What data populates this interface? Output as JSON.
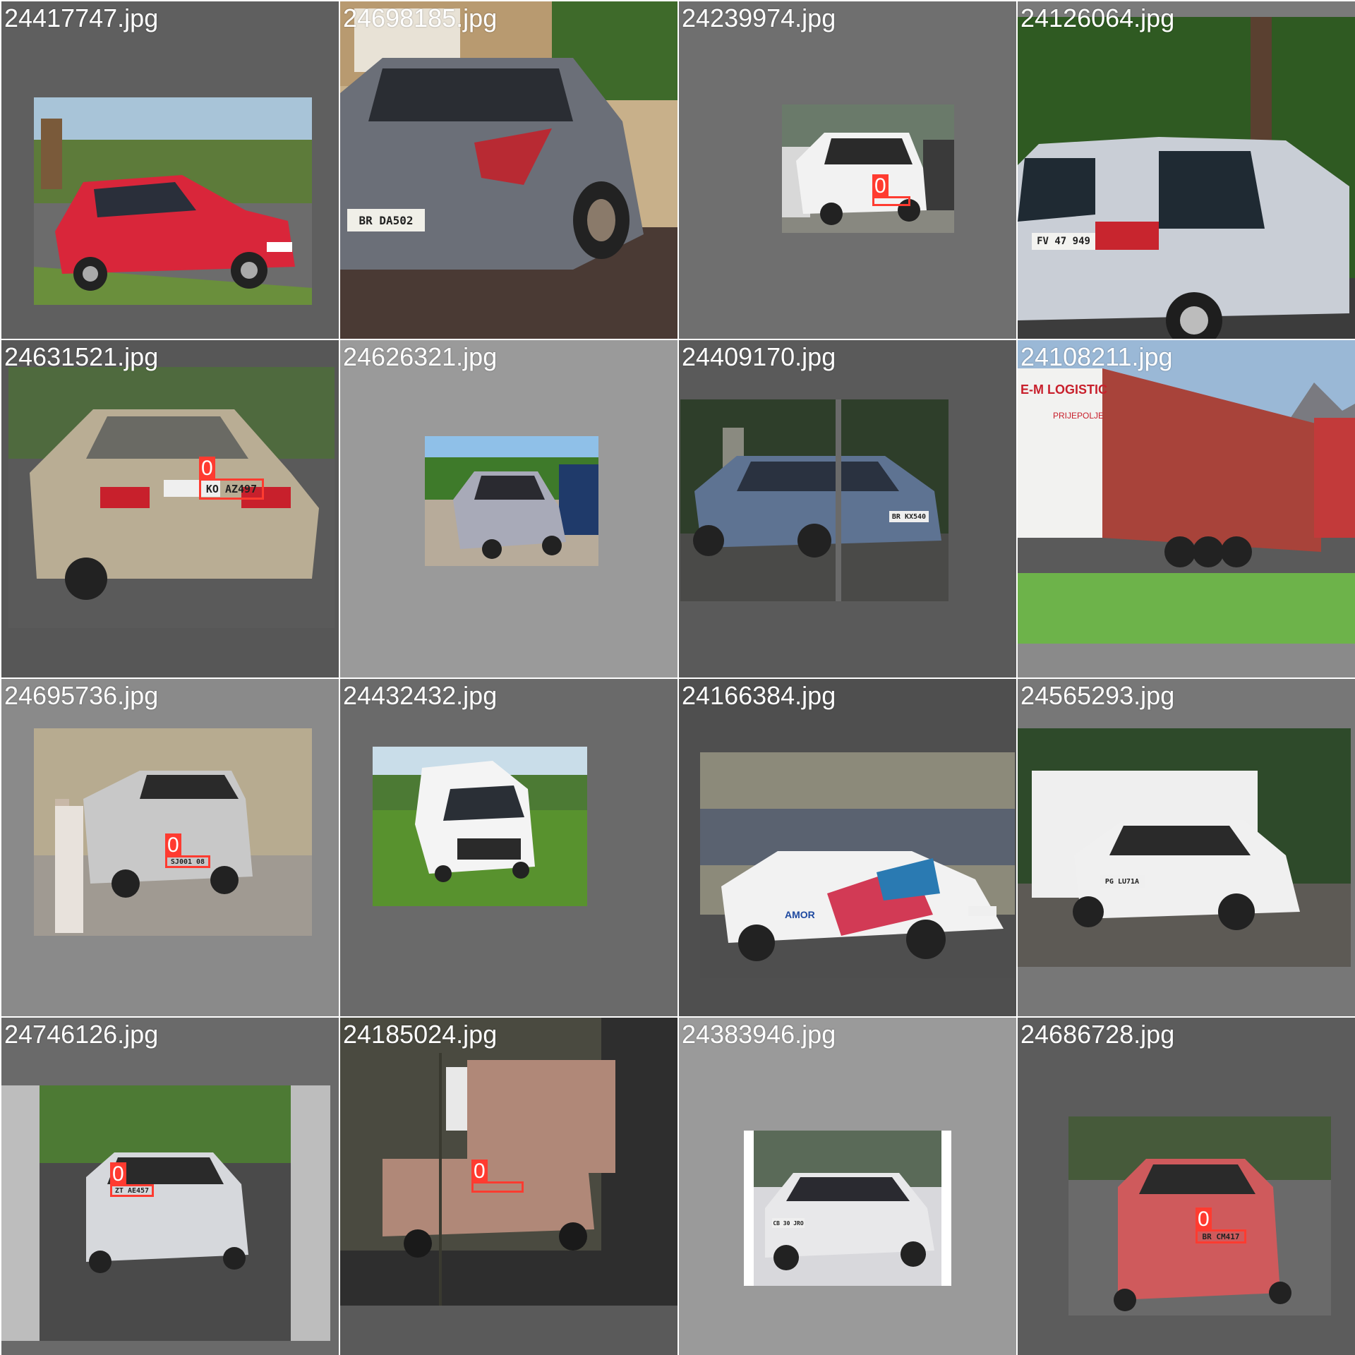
{
  "detection_class_label": "0",
  "box_color": "#ff3b30",
  "tiles": [
    {
      "filename": "24417747.jpg",
      "bg": "#5f5f5f",
      "car_color": "#d9263a",
      "sky": "#a8c4d8",
      "ground": "#6a8f3c"
    },
    {
      "filename": "24698185.jpg",
      "bg": "#8c8c8c",
      "car_color": "#6b6f78",
      "sky": "#c8b08a",
      "ground": "#4a3a34",
      "plate_text": "BR DA502"
    },
    {
      "filename": "24239974.jpg",
      "bg": "#6f6f6f",
      "car_color": "#f2f2f2",
      "sky": "#6a7a6a",
      "ground": "#888880"
    },
    {
      "filename": "24126064.jpg",
      "bg": "#7a7a7a",
      "car_color": "#c9ced6",
      "sky": "#2f5a22",
      "ground": "#3c3c3c",
      "plate_text": "FV 47 949"
    },
    {
      "filename": "24631521.jpg",
      "bg": "#575757",
      "car_color": "#b9ad94",
      "sky": "#4f6a3e",
      "ground": "#5a5a5a",
      "plate_text": "KO AZ497"
    },
    {
      "filename": "24626321.jpg",
      "bg": "#9a9a9a",
      "car_color": "#a8aab8",
      "sky": "#8fc0e8",
      "ground": "#b7ab9a"
    },
    {
      "filename": "24409170.jpg",
      "bg": "#5a5a5a",
      "car_color": "#5e7392",
      "sky": "#2e3e2a",
      "ground": "#4a4a48",
      "plate_text": "BR KX540"
    },
    {
      "filename": "24108211.jpg",
      "bg": "#8a8a8a",
      "car_color": "#a8433a",
      "sky": "#9ab8d6",
      "ground": "#6db34a",
      "company_label": "E-M LOGISTIC",
      "company_sub": "PRIJEPOLJE"
    },
    {
      "filename": "24695736.jpg",
      "bg": "#8a8a8a",
      "car_color": "#c8c8c8",
      "sky": "#b7ab90",
      "ground": "#a09a92",
      "plate_text": "SJ001 08"
    },
    {
      "filename": "24432432.jpg",
      "bg": "#6a6a6a",
      "car_color": "#f4f4f4",
      "sky": "#c9dde9",
      "ground": "#58922e"
    },
    {
      "filename": "24166384.jpg",
      "bg": "#4f4f4f",
      "car_color": "#f2f2f2",
      "sky": "#8c8a7a",
      "ground": "#4e4e4e",
      "brand_text": "AMOR"
    },
    {
      "filename": "24565293.jpg",
      "bg": "#777777",
      "car_color": "#f0f0f0",
      "sky": "#2e4a2a",
      "ground": "#5d5a55",
      "plate_text": "PG LU71A"
    },
    {
      "filename": "24746126.jpg",
      "bg": "#6a6a6a",
      "car_color": "#d6d8dc",
      "sky": "#4d7a34",
      "ground": "#4a4a4a",
      "plate_text": "ZT AE457"
    },
    {
      "filename": "24185024.jpg",
      "bg": "#5a5a5a",
      "car_color": "#b08878",
      "sky": "#4a4a40",
      "ground": "#2e2e2e"
    },
    {
      "filename": "24383946.jpg",
      "bg": "#9a9a9a",
      "car_color": "#e8e8ea",
      "sky": "#5a6a58",
      "ground": "#d8d8dc",
      "plate_text": "CB 30 JRO"
    },
    {
      "filename": "24686728.jpg",
      "bg": "#5c5c5c",
      "car_color": "#cf5a5c",
      "sky": "#465a3a",
      "ground": "#6a6a6a",
      "plate_text": "BR CM417"
    }
  ]
}
